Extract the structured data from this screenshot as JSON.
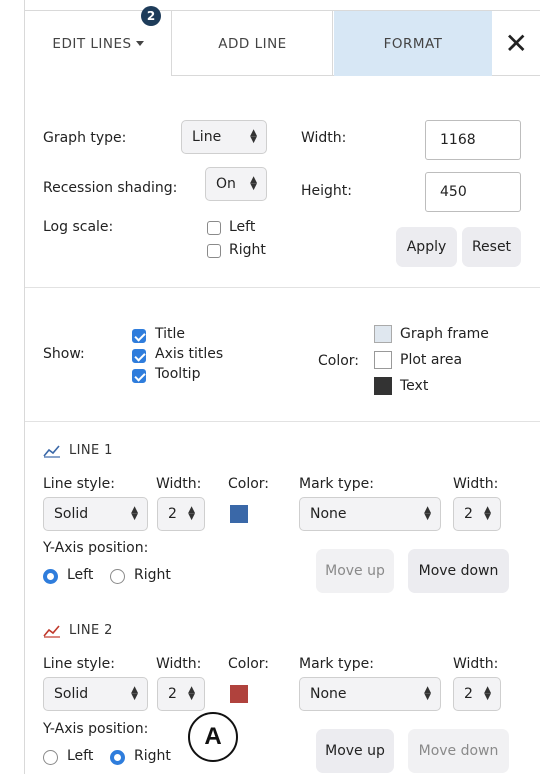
{
  "tabs": {
    "edit_lines": "EDIT LINES",
    "edit_lines_badge": "2",
    "add_line": "ADD LINE",
    "format": "FORMAT",
    "close": "✕"
  },
  "format": {
    "graph_type_label": "Graph type:",
    "graph_type_value": "Line",
    "recession_label": "Recession shading:",
    "recession_value": "On",
    "log_scale_label": "Log scale:",
    "log_left": "Left",
    "log_right": "Right",
    "log_left_checked": false,
    "log_right_checked": false,
    "width_label": "Width:",
    "width_value": "1168",
    "height_label": "Height:",
    "height_value": "450",
    "apply": "Apply",
    "reset": "Reset"
  },
  "show": {
    "label": "Show:",
    "items": [
      {
        "label": "Title",
        "checked": true
      },
      {
        "label": "Axis titles",
        "checked": true
      },
      {
        "label": "Tooltip",
        "checked": true
      }
    ]
  },
  "color": {
    "label": "Color:",
    "items": [
      {
        "label": "Graph frame",
        "color": "#dfe7ef"
      },
      {
        "label": "Plot area",
        "color": "#ffffff"
      },
      {
        "label": "Text",
        "color": "#333333"
      }
    ]
  },
  "lines": [
    {
      "title": "LINE 1",
      "line_style_label": "Line style:",
      "line_style": "Solid",
      "width_label": "Width:",
      "width": "2",
      "color_label": "Color:",
      "color": "#3a68a8",
      "mark_type_label": "Mark type:",
      "mark_type": "None",
      "mark_width_label": "Width:",
      "mark_width": "2",
      "y_axis_label": "Y-Axis position:",
      "y_left": "Left",
      "y_right": "Right",
      "y_selected": "Left",
      "move_up": "Move up",
      "move_down": "Move down",
      "icon_color": "#3a68a8"
    },
    {
      "title": "LINE 2",
      "line_style_label": "Line style:",
      "line_style": "Solid",
      "width_label": "Width:",
      "width": "2",
      "color_label": "Color:",
      "color": "#b0423d",
      "mark_type_label": "Mark type:",
      "mark_type": "None",
      "mark_width_label": "Width:",
      "mark_width": "2",
      "y_axis_label": "Y-Axis position:",
      "y_left": "Left",
      "y_right": "Right",
      "y_selected": "Right",
      "move_up": "Move up",
      "move_down": "Move down",
      "icon_color": "#c0392b"
    }
  ],
  "annotation": "A"
}
